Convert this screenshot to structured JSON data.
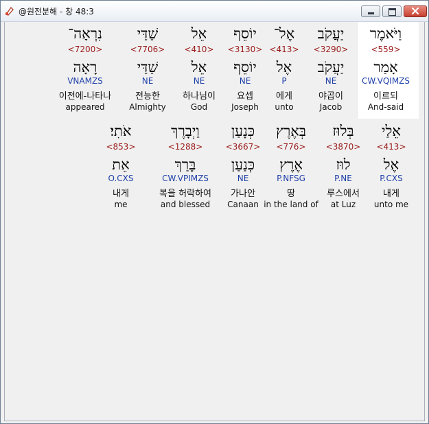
{
  "window": {
    "title": "@원전분해 - 창 48:3",
    "buttons": {
      "minimize": "minimize-icon",
      "maximize": "maximize-icon",
      "close": "close-icon"
    }
  },
  "colors": {
    "strong": "#9b1b1b",
    "parsing": "#1e3fa8",
    "text": "#111111"
  },
  "rows": [
    {
      "words": [
        {
          "hebrew": "וַיֹּאמֶר",
          "strong": "<559>",
          "lemma": "אָמַר",
          "parsing": "CW.VQIMZS",
          "korean": "이르되",
          "english": "And-said",
          "highlighted": true
        },
        {
          "hebrew": "יַעֲקֹב",
          "strong": "<3290>",
          "lemma": "יַעֲקֹב",
          "parsing": "NE",
          "korean": "야곱이",
          "english": "Jacob"
        },
        {
          "hebrew": "אֶל־",
          "strong": "<413>",
          "lemma": "אֶל",
          "parsing": "P",
          "korean": "에게",
          "english": "unto"
        },
        {
          "hebrew": "יוֹסֵף",
          "strong": "<3130>",
          "lemma": "יוֹסֵף",
          "parsing": "NE",
          "korean": "요셉",
          "english": "Joseph"
        },
        {
          "hebrew": "אֵל",
          "strong": "<410>",
          "lemma": "אֵל",
          "parsing": "NE",
          "korean": "하나님이",
          "english": "God"
        },
        {
          "hebrew": "שַׁדַּי",
          "strong": "<7706>",
          "lemma": "שַׁדַּי",
          "parsing": "NE",
          "korean": "전능한",
          "english": "Almighty"
        },
        {
          "hebrew": "נִרְאָה־",
          "strong": "<7200>",
          "lemma": "רָאָה",
          "parsing": "VNAMZS",
          "korean": "이전에-나타나",
          "english": "appeared"
        }
      ]
    },
    {
      "words": [
        {
          "hebrew": "אֵלַי",
          "strong": "<413>",
          "lemma": "אֶל",
          "parsing": "P.CXS",
          "korean": "내게",
          "english": "unto me"
        },
        {
          "hebrew": "בְּלוּז",
          "strong": "<3870>",
          "lemma": "לוּז",
          "parsing": "P.NE",
          "korean": "루스에서",
          "english": "at Luz"
        },
        {
          "hebrew": "בְּאֶרֶץ",
          "strong": "<776>",
          "lemma": "אֶרֶץ",
          "parsing": "P.NFSG",
          "korean": "땅",
          "english": "in the land of"
        },
        {
          "hebrew": "כְּנָעַן",
          "strong": "<3667>",
          "lemma": "כְּנַעַן",
          "parsing": "NE",
          "korean": "가나안",
          "english": "Canaan"
        },
        {
          "hebrew": "וַיְבָרֶךְ",
          "strong": "<1288>",
          "lemma": "בָּרַךְ",
          "parsing": "CW.VPIMZS",
          "korean": "복을 허락하여",
          "english": "and blessed"
        },
        {
          "hebrew": "אֹתִי׃",
          "strong": "<853>",
          "lemma": "אֵת",
          "parsing": "O.CXS",
          "korean": "내게",
          "english": "me"
        }
      ]
    }
  ]
}
